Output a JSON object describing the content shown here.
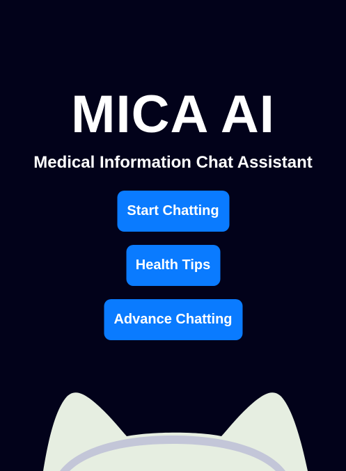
{
  "hero": {
    "title": "MICA AI",
    "subtitle": "Medical Information Chat Assistant"
  },
  "actions": {
    "start_chatting": "Start Chatting",
    "health_tips": "Health Tips",
    "advance_chatting": "Advance Chatting"
  },
  "colors": {
    "background": "#02021a",
    "button": "#0a7bff",
    "mascot_body": "#e6eee1",
    "mascot_band": "#c3c6d8"
  },
  "icons": {
    "mascot": "cat-ears-mascot"
  }
}
